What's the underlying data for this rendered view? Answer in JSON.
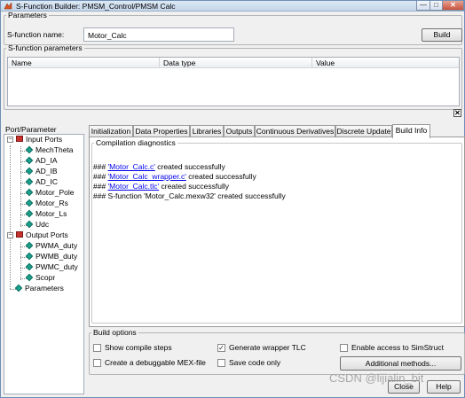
{
  "window": {
    "title": "S-Function Builder: PMSM_Control/PMSM Calc",
    "min_glyph": "—",
    "max_glyph": "□",
    "close_glyph": "✕"
  },
  "parameters": {
    "legend": "Parameters",
    "sfunction_name_label": "S-function name:",
    "sfunction_name_value": "Motor_Calc",
    "build_button": "Build"
  },
  "sfunction_parameters": {
    "legend": "S-function parameters",
    "columns": [
      "Name",
      "Data type",
      "Value"
    ],
    "delete_glyph": "✕"
  },
  "port_parameter": {
    "legend": "Port/Parameter",
    "tree": {
      "input_ports": {
        "label": "Input Ports",
        "expander": "−",
        "items": [
          "MechTheta",
          "AD_IA",
          "AD_IB",
          "AD_IC",
          "Motor_Pole",
          "Motor_Rs",
          "Motor_Ls",
          "Udc"
        ]
      },
      "output_ports": {
        "label": "Output Ports",
        "expander": "−",
        "items": [
          "PWMA_duty",
          "PWMB_duty",
          "PWMC_duty",
          "Scopr"
        ]
      },
      "parameters_label": "Parameters"
    }
  },
  "tabs": [
    {
      "label": "Initialization"
    },
    {
      "label": "Data Properties"
    },
    {
      "label": "Libraries"
    },
    {
      "label": "Outputs"
    },
    {
      "label": "Continuous Derivatives"
    },
    {
      "label": "Discrete Update"
    },
    {
      "label": "Build Info"
    }
  ],
  "active_tab": "Build Info",
  "compilation": {
    "legend": "Compilation diagnostics",
    "lines": [
      {
        "prefix": "### ",
        "link": "'Motor_Calc.c'",
        "suffix": " created successfully"
      },
      {
        "prefix": "### ",
        "link": "'Motor_Calc_wrapper.c'",
        "suffix": " created successfully"
      },
      {
        "prefix": "### ",
        "link": "'Motor_Calc.tlc'",
        "suffix": " created successfully"
      },
      {
        "prefix": "### S-function 'Motor_Calc.mexw32' created successfully",
        "link": "",
        "suffix": ""
      }
    ]
  },
  "build_options": {
    "legend": "Build options",
    "show_compile_steps": {
      "label": "Show compile steps",
      "checked": false
    },
    "debuggable_mex": {
      "label": "Create a debuggable MEX-file",
      "checked": false
    },
    "generate_wrapper_tlc": {
      "label": "Generate wrapper TLC",
      "checked": true
    },
    "save_code_only": {
      "label": "Save code only",
      "checked": false
    },
    "enable_simstruct": {
      "label": "Enable access to SimStruct",
      "checked": false
    },
    "additional_methods_button": "Additional methods...",
    "check_glyph": "✓"
  },
  "footer": {
    "close_button": "Close",
    "help_button": "Help"
  },
  "watermark": "CSDN @lijialin_bit",
  "colors": {
    "link": "#0000ee",
    "tree_diamond": "#19a28e",
    "ports_icon": "#c7322d"
  }
}
